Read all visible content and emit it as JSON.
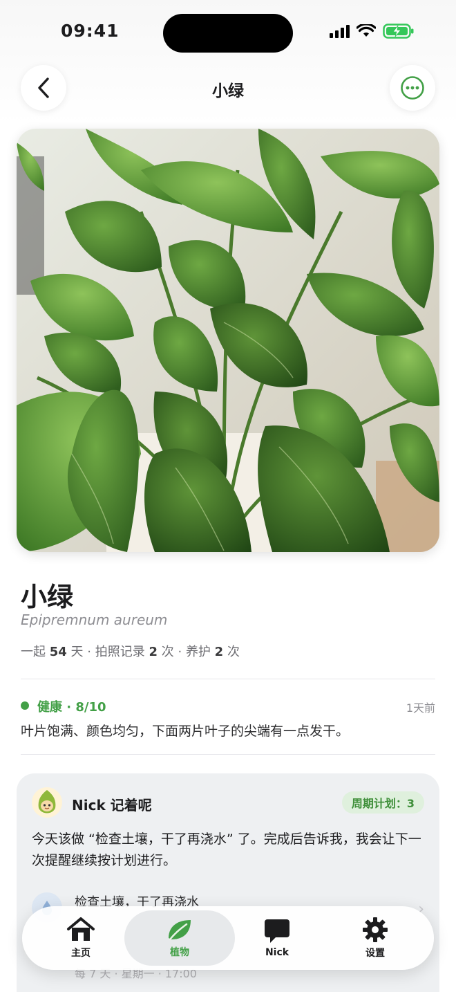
{
  "status_bar": {
    "time": "09:41"
  },
  "nav": {
    "title": "小绿",
    "back_icon": "chevron-left-icon",
    "more_icon": "more-icon",
    "accent": "#43a047"
  },
  "plant": {
    "name": "小绿",
    "latin": "Epipremnum aureum",
    "stats": {
      "together_prefix": "一起",
      "together_days": "54",
      "together_unit": "天",
      "photo_label": "拍照记录",
      "photo_count": "2",
      "photo_unit": "次",
      "care_label": "养护",
      "care_count": "2",
      "care_unit": "次",
      "separator": "·"
    }
  },
  "health": {
    "status": "健康 · 8/10",
    "time_ago": "1天前",
    "description": "叶片饱满、颜色均匀，下面两片叶子的尖端有一点发干。",
    "color": "#43a047"
  },
  "nick_card": {
    "name": "Nick 记着呢",
    "plan_badge": "周期计划：3",
    "message": "今天该做 “检查土壤，干了再浇水” 了。完成后告诉我，我会让下一次提醒继续按计划进行。",
    "task": {
      "title": "检查土壤，干了再浇水",
      "schedule": "每 7 天 · 星期一 · 17:00"
    }
  },
  "tabbar": {
    "tabs": [
      {
        "label": "主页",
        "icon": "home-icon"
      },
      {
        "label": "植物",
        "icon": "leaf-icon",
        "active": true
      },
      {
        "label": "Nick",
        "icon": "chat-bubble-icon"
      },
      {
        "label": "设置",
        "icon": "gear-icon"
      }
    ]
  }
}
